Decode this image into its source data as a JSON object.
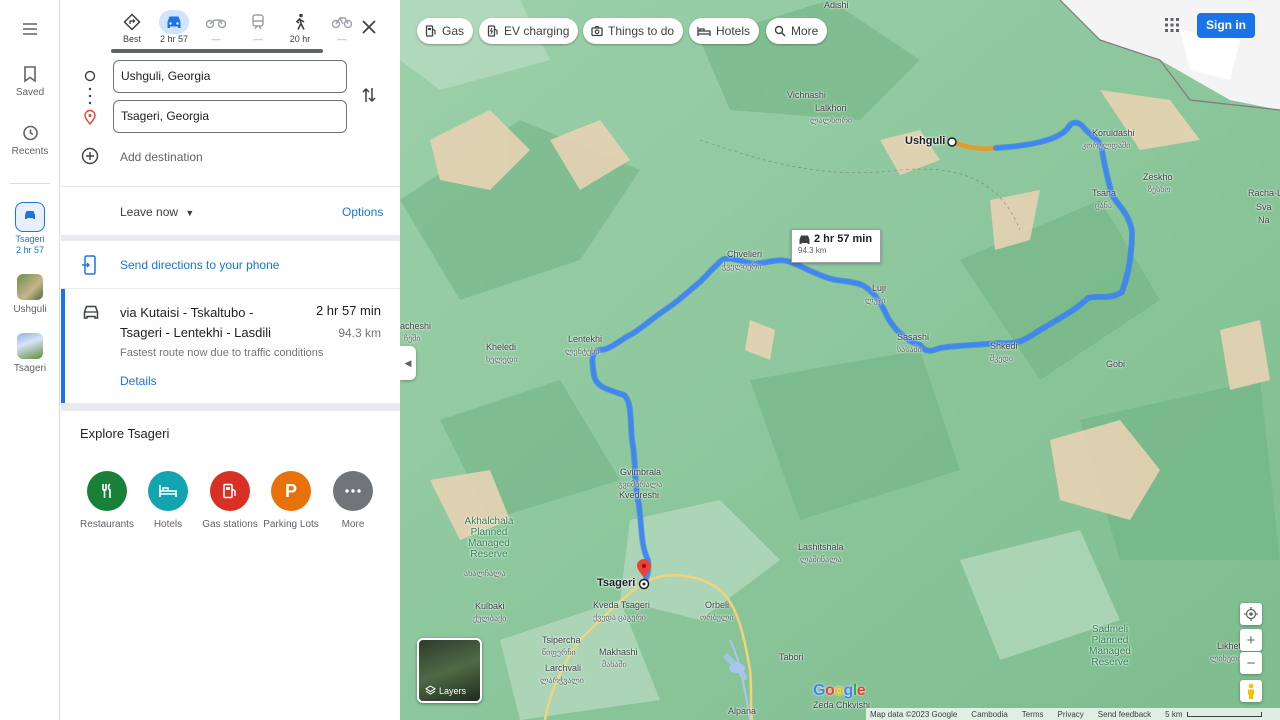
{
  "rail": {
    "menu_icon": "hamburger-icon",
    "saved": "Saved",
    "recents": "Recents",
    "active_label": "Tsageri",
    "active_sub": "2 hr 57",
    "thumb1": "Ushguli",
    "thumb2": "Tsageri"
  },
  "modes": [
    {
      "label": "Best"
    },
    {
      "label": "2 hr 57"
    },
    {
      "label": "—"
    },
    {
      "label": "—"
    },
    {
      "label": "20 hr"
    },
    {
      "label": "—"
    }
  ],
  "directions": {
    "origin": "Ushguli, Georgia",
    "destination": "Tsageri, Georgia",
    "add_destination": "Add destination",
    "leave_now": "Leave now",
    "options": "Options",
    "send_to_phone": "Send directions to your phone"
  },
  "route": {
    "via": "via Kutaisi - Tskaltubo - Tsageri - Lentekhi - Lasdili",
    "time": "2 hr 57 min",
    "distance": "94.3 km",
    "note": "Fastest route now due to traffic conditions",
    "details": "Details"
  },
  "explore": {
    "title": "Explore Tsageri",
    "categories": [
      {
        "label": "Restaurants",
        "color": "#188038"
      },
      {
        "label": "Hotels",
        "color": "#12a4af"
      },
      {
        "label": "Gas stations",
        "color": "#d93025"
      },
      {
        "label": "Parking Lots",
        "color": "#e8710a"
      },
      {
        "label": "More",
        "color": "#70757a"
      }
    ]
  },
  "map": {
    "chips": [
      "Gas",
      "EV charging",
      "Things to do",
      "Hotels",
      "More"
    ],
    "sign_in": "Sign in",
    "route_box": {
      "time": "2 hr 57 min",
      "distance": "94.3 km"
    },
    "towns": {
      "ushguli": "Ushguli",
      "tsageri": "Tsageri"
    },
    "labels": {
      "vichnashi": "Vichnashi",
      "lalkhori": "Lalkhori",
      "lalkhori_ka": "ლალხორი",
      "koruldashi": "Koruldashi",
      "koruldashi_ka": "კორულდაში",
      "zeskho": "Zeskho",
      "zeskho_ka": "ზესხო",
      "tsana": "Tsana",
      "tsana_ka": "ცანა",
      "racha": "Racha-L",
      "racha2": "Sva",
      "racha3": "Na",
      "chvelieri": "Chvelieri",
      "chvelieri_ka": "ჭველიერი",
      "luji": "Luji",
      "luji_ka": "ლუჯი",
      "sasashi": "Sasashi",
      "sasashi_ka": "სასაში",
      "shkedi": "Shkedi",
      "shkedi_ka": "შკედი",
      "gobi": "Gobi",
      "lentekhi": "Lentekhi",
      "lentekhi_ka": "ლენტეხი",
      "kheledi": "Kheledi",
      "kheledi_ka": "ხელედი",
      "achreshi": "acheshi",
      "achreshi_ka": "ჩეში",
      "gvimbrala": "Gvimbrala",
      "gvimbrala_ka": "გვიმბრალა",
      "kvedreshi": "Kvedreshi",
      "akhalchala": "Akhalchala Planned Managed Reserve",
      "akhalchala_ka": "ახალჩალა",
      "kulbaki": "Kulbaki",
      "kulbaki_ka": "ქულბაქი",
      "lashitshala": "Lashitshala",
      "lashitshala_ka": "ლაშიწალა",
      "kveda_tsageri": "Kveda Tsageri",
      "kveda_tsageri_ka": "ქვედა ცაგერი",
      "orbeli": "Orbeli",
      "orbeli_ka": "ორბელი",
      "tsipercha": "Tsipercha",
      "tsipercha_ka": "წიფერჩი",
      "makhashi": "Makhashi",
      "makhashi_ka": "მახაში",
      "larchvali": "Larchvali",
      "larchvali_ka": "ლარჭვალი",
      "tabori": "Tabori",
      "sadmeli": "Sadmeli Planned Managed Reserve",
      "likheti": "Likheti",
      "likheti_ka": "ლიხეთი",
      "alpana": "Alpana",
      "zeda_chkvishi": "Zeda Chkvishi",
      "adishi": "Adishi"
    },
    "layers": "Layers",
    "footer": {
      "data": "Map data ©2023 Google",
      "country": "Cambodia",
      "terms": "Terms",
      "privacy": "Privacy",
      "feedback": "Send feedback",
      "scale": "5 km"
    }
  }
}
